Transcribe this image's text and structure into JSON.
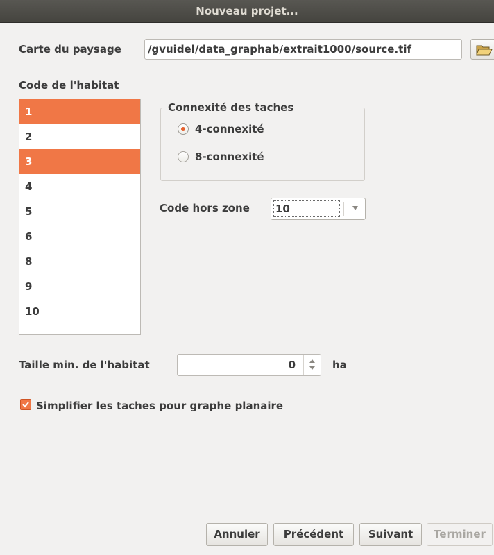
{
  "window": {
    "title": "Nouveau projet..."
  },
  "landscape": {
    "label": "Carte du paysage",
    "path": "/gvuidel/data_graphab/extrait1000/source.tif",
    "browse_icon": "folder-open-icon"
  },
  "habitat": {
    "label": "Code de l'habitat",
    "codes": [
      {
        "value": "1",
        "selected": true
      },
      {
        "value": "2",
        "selected": false
      },
      {
        "value": "3",
        "selected": true
      },
      {
        "value": "4",
        "selected": false
      },
      {
        "value": "5",
        "selected": false
      },
      {
        "value": "6",
        "selected": false
      },
      {
        "value": "8",
        "selected": false
      },
      {
        "value": "9",
        "selected": false
      },
      {
        "value": "10",
        "selected": false
      }
    ]
  },
  "connexity": {
    "title": "Connexité des taches",
    "options": [
      {
        "label": "4-connexité",
        "checked": true
      },
      {
        "label": "8-connexité",
        "checked": false
      }
    ]
  },
  "nodata": {
    "label": "Code hors zone",
    "value": "10"
  },
  "min_size": {
    "label": "Taille min. de l'habitat",
    "value": "0",
    "unit": "ha"
  },
  "simplify": {
    "label": "Simplifier les taches pour graphe planaire",
    "checked": true
  },
  "buttons": {
    "cancel": "Annuler",
    "previous": "Précédent",
    "next": "Suivant",
    "finish": "Terminer"
  },
  "colors": {
    "selection": "#f07746",
    "accent": "#e5612e"
  }
}
